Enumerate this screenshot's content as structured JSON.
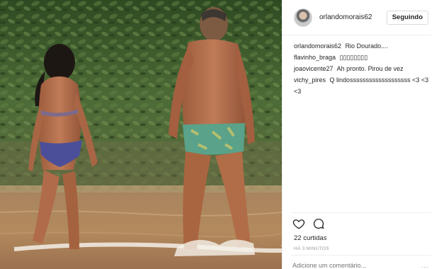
{
  "header": {
    "username": "orlandomorais62",
    "follow_label": "Seguindo"
  },
  "comments": [
    {
      "author": "orlandomorais62",
      "text": "Rio Dourado...."
    },
    {
      "author": "flavinho_braga",
      "text": "▯▯▯▯▯▯▯▯"
    },
    {
      "author": "joaovicente27",
      "text": "Ah pronto. Pirou de vez"
    },
    {
      "author": "vichy_pires",
      "text": "Q lindosssssssssssssssssss <3 <3 <3"
    }
  ],
  "actions": {
    "like_icon": "heart-icon",
    "comment_icon": "comment-icon"
  },
  "likes_text": "22 curtidas",
  "time_text": "HÁ 3 MINUTOS",
  "comment_box": {
    "placeholder": "Adicione um comentário..."
  },
  "more_label": "...",
  "colors": {
    "border": "#efefef",
    "text": "#262626",
    "muted": "#999999",
    "foliage": "#3b5a2c",
    "water": "#b2835a"
  }
}
